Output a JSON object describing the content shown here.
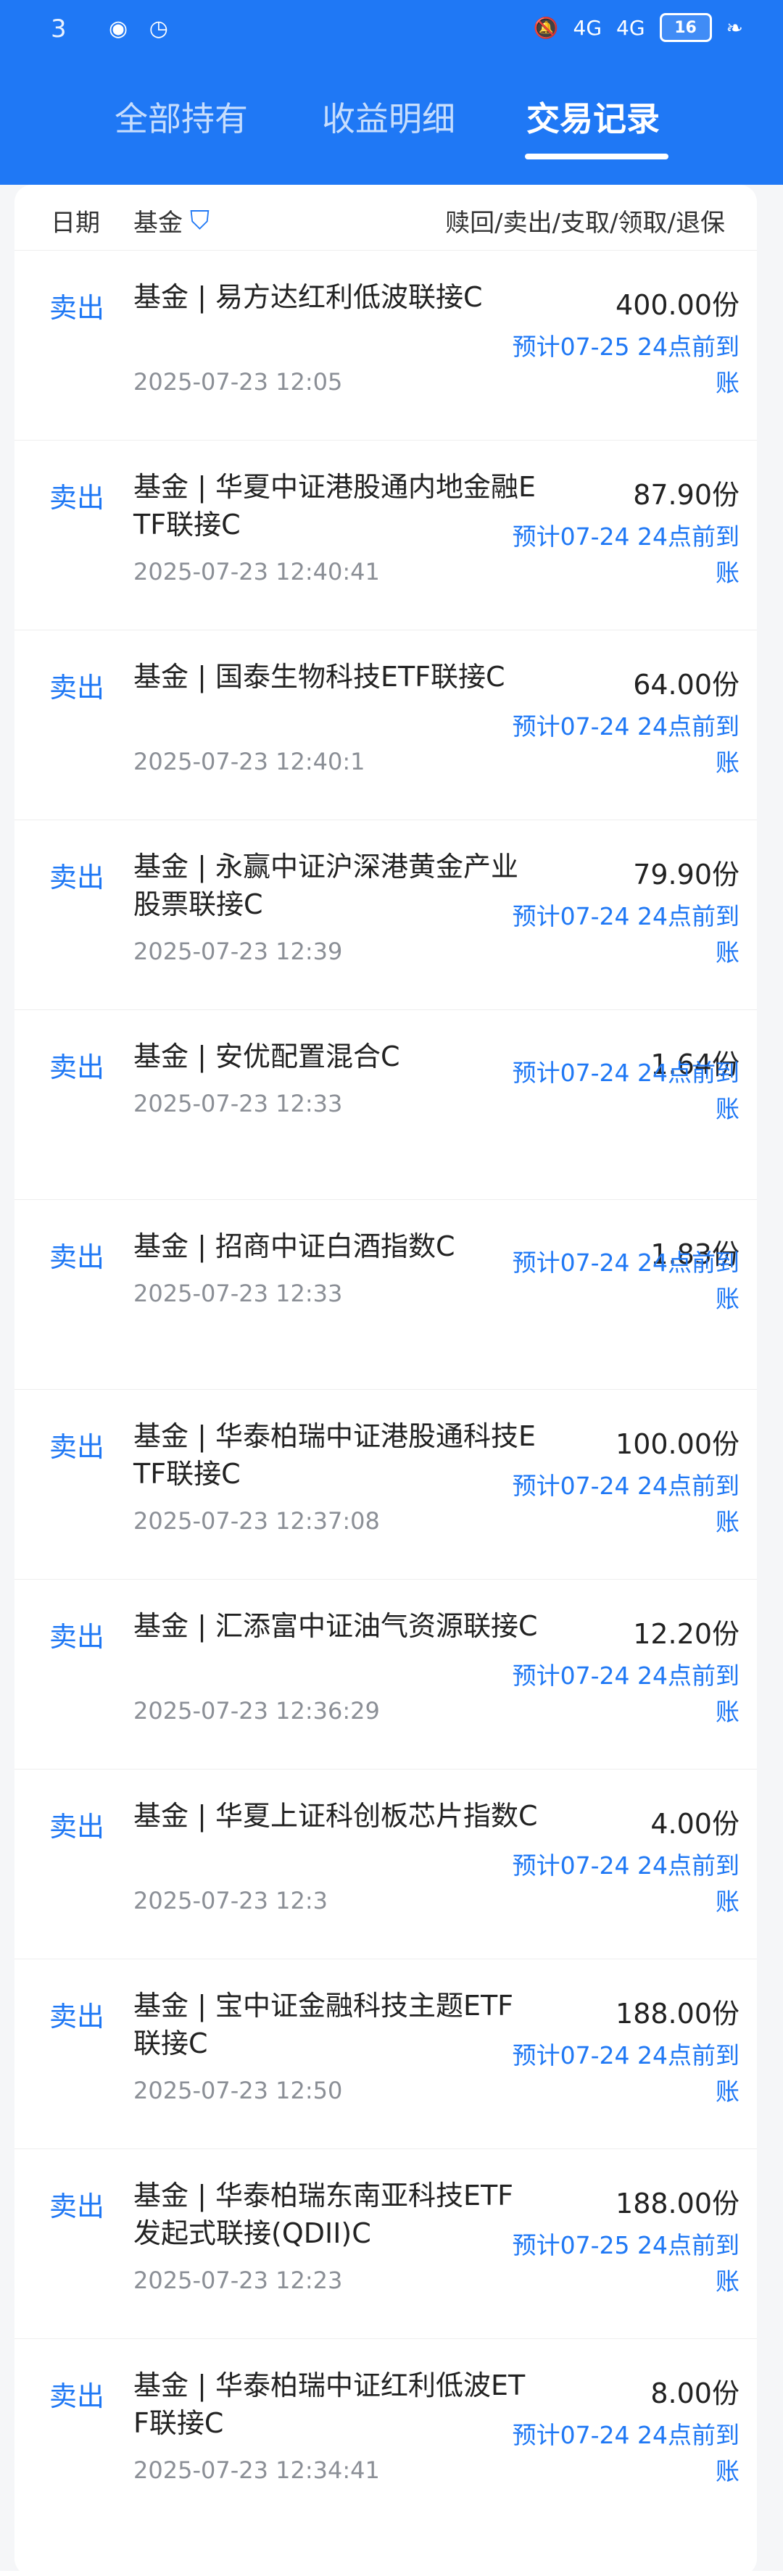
{
  "status": {
    "time": "3",
    "battery": "16",
    "signal_1": "4G",
    "signal_2": "4G"
  },
  "tabs": [
    {
      "label": "全部持有"
    },
    {
      "label": "收益明细"
    },
    {
      "label": "交易记录"
    }
  ],
  "header": {
    "date": "日期",
    "type": "基金",
    "action": "赎回/卖出/支取/领取/退保"
  },
  "rows": [
    {
      "op": "卖出",
      "name": "基金 | 易方达红利低波联接C",
      "time": "2025-07-23 12:05",
      "amount": "400.00份",
      "eta": "预计07-25 24点前到账"
    },
    {
      "op": "卖出",
      "name": "基金 | 华夏中证港股通内地金融ETF联接C",
      "time": "2025-07-23 12:40:41",
      "amount": "87.90份",
      "eta": "预计07-24 24点前到账"
    },
    {
      "op": "卖出",
      "name": "基金 | 国泰生物科技ETF联接C",
      "time": "2025-07-23 12:40:1",
      "amount": "64.00份",
      "eta": "预计07-24 24点前到账"
    },
    {
      "op": "卖出",
      "name": "基金 | 永赢中证沪深港黄金产业股票联接C",
      "time": "2025-07-23 12:39",
      "amount": "79.90份",
      "eta": "预计07-24 24点前到账"
    },
    {
      "op": "卖出",
      "name": "基金 | 安优配置混合C",
      "time": "2025-07-23 12:33",
      "amount": "1.64份",
      "eta": "预计07-24 24点前到账"
    },
    {
      "op": "卖出",
      "name": "基金 | 招商中证白酒指数C",
      "time": "2025-07-23 12:33",
      "amount": "1.83份",
      "eta": "预计07-24 24点前到账"
    },
    {
      "op": "卖出",
      "name": "基金 | 华泰柏瑞中证港股通科技ETF联接C",
      "time": "2025-07-23 12:37:08",
      "amount": "100.00份",
      "eta": "预计07-24 24点前到账"
    },
    {
      "op": "卖出",
      "name": "基金 | 汇添富中证油气资源联接C",
      "time": "2025-07-23 12:36:29",
      "amount": "12.20份",
      "eta": "预计07-24 24点前到账"
    },
    {
      "op": "卖出",
      "name": "基金 | 华夏上证科创板芯片指数C",
      "time": "2025-07-23 12:3",
      "amount": "4.00份",
      "eta": "预计07-24 24点前到账"
    },
    {
      "op": "卖出",
      "name": "基金 | 宝中证金融科技主题ETF联接C",
      "time": "2025-07-23 12:50",
      "amount": "188.00份",
      "eta": "预计07-24 24点前到账"
    },
    {
      "op": "卖出",
      "name": "基金 | 华泰柏瑞东南亚科技ETF发起式联接(QDII)C",
      "time": "2025-07-23 12:23",
      "amount": "188.00份",
      "eta": "预计07-25 24点前到账"
    },
    {
      "op": "卖出",
      "name": "基金 | 华泰柏瑞中证红利低波ETF联接C",
      "time": "2025-07-23 12:34:41",
      "amount": "8.00份",
      "eta": "预计07-24 24点前到账"
    }
  ]
}
